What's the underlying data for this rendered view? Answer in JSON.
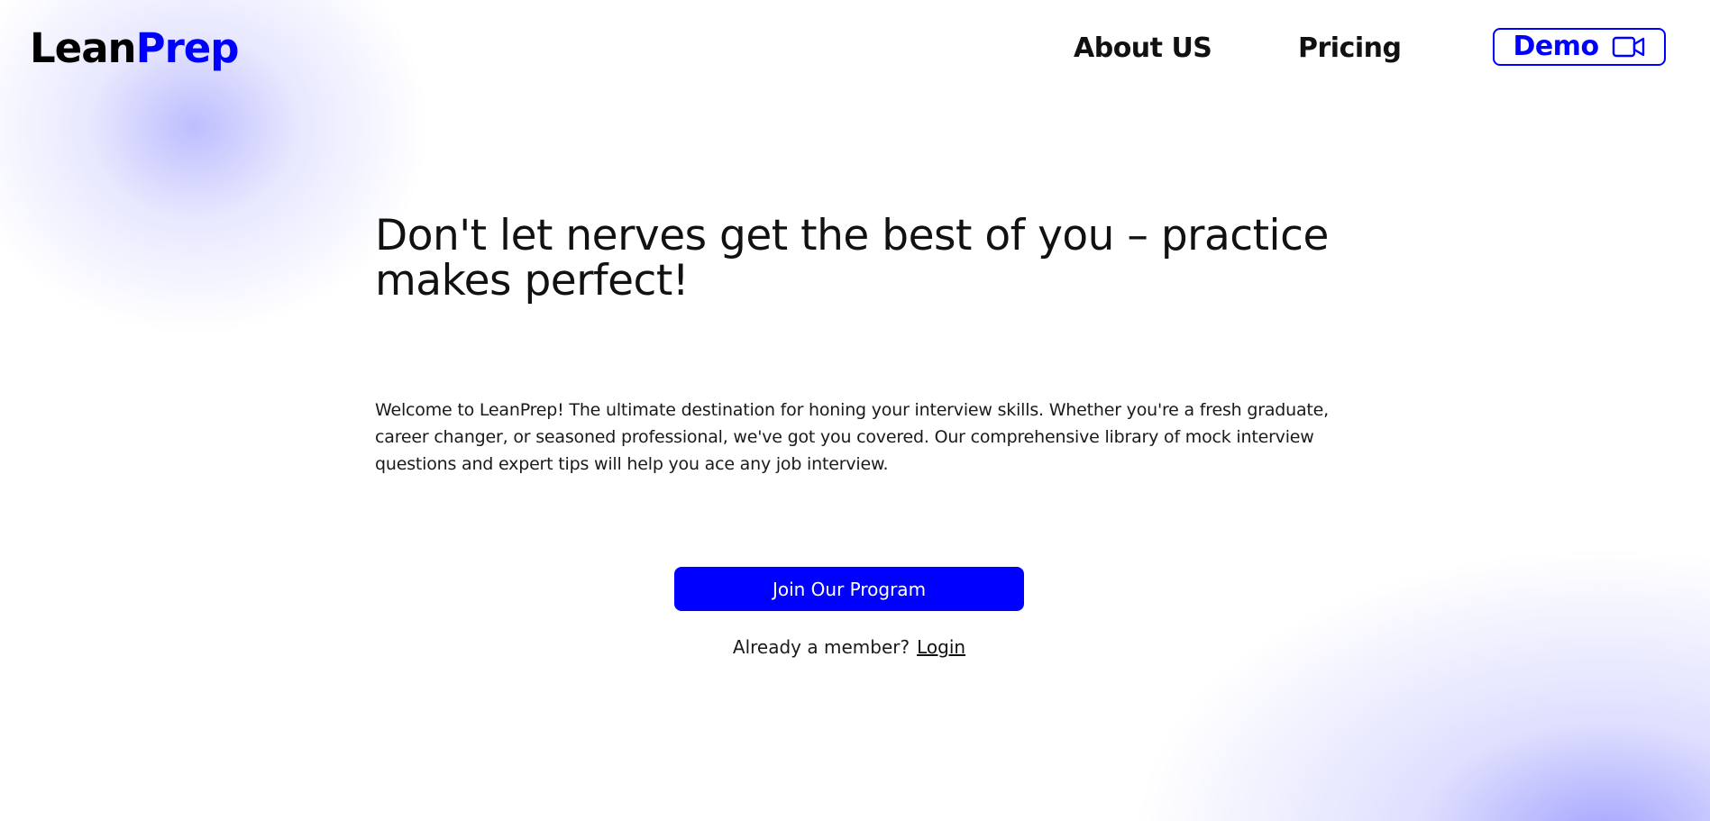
{
  "brand": {
    "name_part1": "Lean",
    "name_part2": "Prep",
    "accent_color": "#0000ff"
  },
  "nav": {
    "links": [
      {
        "label": "About US"
      },
      {
        "label": "Pricing"
      }
    ],
    "demo_button": {
      "label": "Demo",
      "icon": "video-camera-icon"
    }
  },
  "hero": {
    "headline": "Don't let nerves get the best of you – practice makes perfect!",
    "description": "Welcome to LeanPrep! The ultimate destination for honing your interview skills. Whether you're a fresh graduate, career changer, or seasoned professional, we've got you covered. Our comprehensive library of mock interview questions and expert tips will help you ace any job interview.",
    "cta_label": "Join Our Program",
    "member_prompt": "Already a member?",
    "login_label": "Login"
  }
}
